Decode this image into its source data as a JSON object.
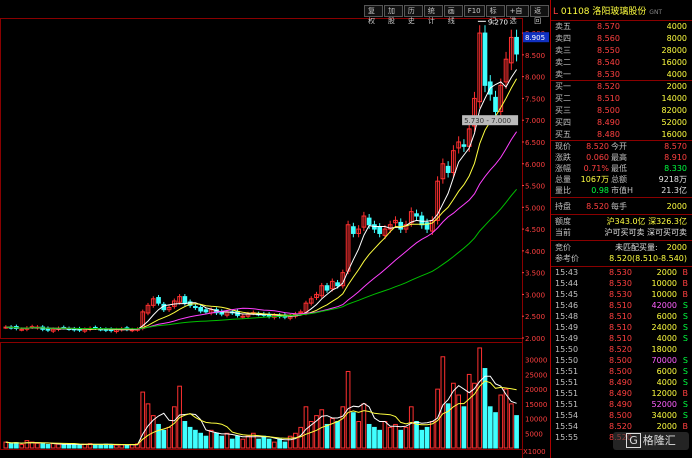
{
  "toolbar": {
    "buttons": [
      "复权",
      "加股",
      "历史",
      "统计",
      "画线",
      "F10",
      "标记",
      "+自选",
      "返回"
    ]
  },
  "stock": {
    "code": "01108",
    "name": "洛阳玻璃股份",
    "suffix": "GNT"
  },
  "chart_annotations": {
    "high_label": "9.270",
    "low_label": "5.730 - 7.000",
    "current_price_tag": "8.905",
    "volume_multiplier": "X1000"
  },
  "price_axis": [
    "9.000",
    "8.500",
    "8.000",
    "7.500",
    "7.000",
    "6.500",
    "6.000",
    "5.500",
    "5.000",
    "4.500",
    "4.000",
    "3.500",
    "3.000",
    "2.500",
    "2.000"
  ],
  "volume_axis": [
    "30000",
    "25000",
    "20000",
    "15000",
    "10000",
    "5000"
  ],
  "order_book": {
    "asks": [
      {
        "label": "卖五",
        "price": "8.570",
        "volume": "4000"
      },
      {
        "label": "卖四",
        "price": "8.560",
        "volume": "8000"
      },
      {
        "label": "卖三",
        "price": "8.550",
        "volume": "28000"
      },
      {
        "label": "卖二",
        "price": "8.540",
        "volume": "16000"
      },
      {
        "label": "卖一",
        "price": "8.530",
        "volume": "4000"
      }
    ],
    "bids": [
      {
        "label": "买一",
        "price": "8.520",
        "volume": "2000"
      },
      {
        "label": "买二",
        "price": "8.510",
        "volume": "14000"
      },
      {
        "label": "买三",
        "price": "8.500",
        "volume": "82000"
      },
      {
        "label": "买四",
        "price": "8.490",
        "volume": "52000"
      },
      {
        "label": "买五",
        "price": "8.480",
        "volume": "16000"
      }
    ]
  },
  "quote": {
    "rows": [
      {
        "l1": "现价",
        "v1": "8.520",
        "l2": "今开",
        "v2": "8.570",
        "c1": "red",
        "c2": "red"
      },
      {
        "l1": "涨跌",
        "v1": "0.060",
        "l2": "最高",
        "v2": "8.910",
        "c1": "red",
        "c2": "red"
      },
      {
        "l1": "涨幅",
        "v1": "0.71%",
        "l2": "最低",
        "v2": "8.330",
        "c1": "red",
        "c2": "grn"
      },
      {
        "l1": "总量",
        "v1": "1067万",
        "l2": "总额",
        "v2": "9218万",
        "c1": "yel",
        "c2": "wht"
      },
      {
        "l1": "量比",
        "v1": "0.98",
        "l2": "市值H",
        "v2": "21.3亿",
        "c1": "grn",
        "c2": "wht"
      }
    ],
    "handicap": {
      "l1": "持盘",
      "v1": "8.520",
      "l2": "每手",
      "v2": "2000"
    },
    "connect": {
      "l1": "额度",
      "v1": "沪343.0亿 深326.3亿"
    },
    "current": {
      "l1": "当前",
      "v1": "沪可买可卖 深可买可卖"
    },
    "auction": {
      "l1": "竞价",
      "v1": "未匹配买量:",
      "v2": "2000"
    },
    "ref": {
      "l1": "参考价",
      "v1": "8.520(8.510-8.540)"
    }
  },
  "ticks": [
    {
      "time": "15:43",
      "price": "8.530",
      "vol": "2000",
      "side": "B"
    },
    {
      "time": "15:44",
      "price": "8.530",
      "vol": "10000",
      "side": "B"
    },
    {
      "time": "15:45",
      "price": "8.530",
      "vol": "10000",
      "side": "B"
    },
    {
      "time": "15:46",
      "price": "8.510",
      "vol": "42000",
      "side": "S"
    },
    {
      "time": "15:48",
      "price": "8.510",
      "vol": "6000",
      "side": "S"
    },
    {
      "time": "15:49",
      "price": "8.510",
      "vol": "24000",
      "side": "S"
    },
    {
      "time": "15:49",
      "price": "8.510",
      "vol": "4000",
      "side": "S"
    },
    {
      "time": "15:50",
      "price": "8.520",
      "vol": "18000",
      "side": ""
    },
    {
      "time": "15:50",
      "price": "8.500",
      "vol": "70000",
      "side": "S"
    },
    {
      "time": "15:51",
      "price": "8.500",
      "vol": "6000",
      "side": "S"
    },
    {
      "time": "15:51",
      "price": "8.490",
      "vol": "4000",
      "side": "S"
    },
    {
      "time": "15:51",
      "price": "8.490",
      "vol": "12000",
      "side": "B"
    },
    {
      "time": "15:51",
      "price": "8.490",
      "vol": "52000",
      "side": "S"
    },
    {
      "time": "15:54",
      "price": "8.500",
      "vol": "34000",
      "side": "S"
    },
    {
      "time": "15:54",
      "price": "8.520",
      "vol": "2000",
      "side": "B"
    },
    {
      "time": "15:55",
      "price": "8.520",
      "vol": "",
      "side": ""
    }
  ],
  "watermark": "格隆汇",
  "colors": {
    "up": "#ff3030",
    "down": "#40ffff",
    "ma5": "#ffffff",
    "ma10": "#ffff40",
    "ma20": "#ff40ff",
    "ma60": "#00c000",
    "border": "#b00000"
  },
  "chart_data": {
    "type": "candlestick",
    "ylim": [
      2.0,
      9.3
    ],
    "closes": [
      2.25,
      2.24,
      2.22,
      2.2,
      2.23,
      2.26,
      2.25,
      2.2,
      2.18,
      2.2,
      2.22,
      2.24,
      2.21,
      2.19,
      2.18,
      2.2,
      2.22,
      2.23,
      2.2,
      2.18,
      2.17,
      2.19,
      2.21,
      2.2,
      2.19,
      2.2,
      2.6,
      2.75,
      2.9,
      2.8,
      2.65,
      2.7,
      2.85,
      2.95,
      2.8,
      2.75,
      2.7,
      2.62,
      2.6,
      2.65,
      2.58,
      2.55,
      2.6,
      2.58,
      2.52,
      2.5,
      2.55,
      2.58,
      2.55,
      2.52,
      2.5,
      2.52,
      2.5,
      2.48,
      2.5,
      2.55,
      2.6,
      2.8,
      2.9,
      3.0,
      3.2,
      3.1,
      3.3,
      3.2,
      3.5,
      4.6,
      4.4,
      4.5,
      4.8,
      4.6,
      4.5,
      4.4,
      4.5,
      4.6,
      4.7,
      4.5,
      4.6,
      4.9,
      4.8,
      4.6,
      4.5,
      4.7,
      5.6,
      6.0,
      5.8,
      6.3,
      6.5,
      6.4,
      6.8,
      7.5,
      9.0,
      7.8,
      7.6,
      7.2,
      7.8,
      8.4,
      8.9,
      8.52
    ],
    "volumes": [
      2000,
      1500,
      1800,
      1200,
      2500,
      2000,
      1600,
      1400,
      1200,
      1500,
      1300,
      1100,
      1400,
      1200,
      1000,
      1300,
      1500,
      1200,
      1100,
      1300,
      1200,
      1000,
      1100,
      900,
      1200,
      1400,
      19000,
      15000,
      11000,
      8000,
      6000,
      7000,
      14000,
      21000,
      9000,
      7000,
      6000,
      5000,
      4000,
      6000,
      5000,
      4000,
      5000,
      3000,
      4000,
      3000,
      4000,
      5000,
      3000,
      4000,
      3000,
      2000,
      3000,
      2000,
      4000,
      5000,
      7000,
      14000,
      9000,
      11000,
      13000,
      8000,
      10000,
      9000,
      14000,
      26000,
      12000,
      9000,
      15000,
      8000,
      7000,
      6000,
      9000,
      7000,
      8000,
      6000,
      7000,
      14000,
      9000,
      6000,
      7000,
      9000,
      20000,
      31000,
      15000,
      22000,
      18000,
      14000,
      25000,
      22000,
      34000,
      27000,
      14000,
      12000,
      18000,
      20000,
      15000,
      11000
    ]
  }
}
